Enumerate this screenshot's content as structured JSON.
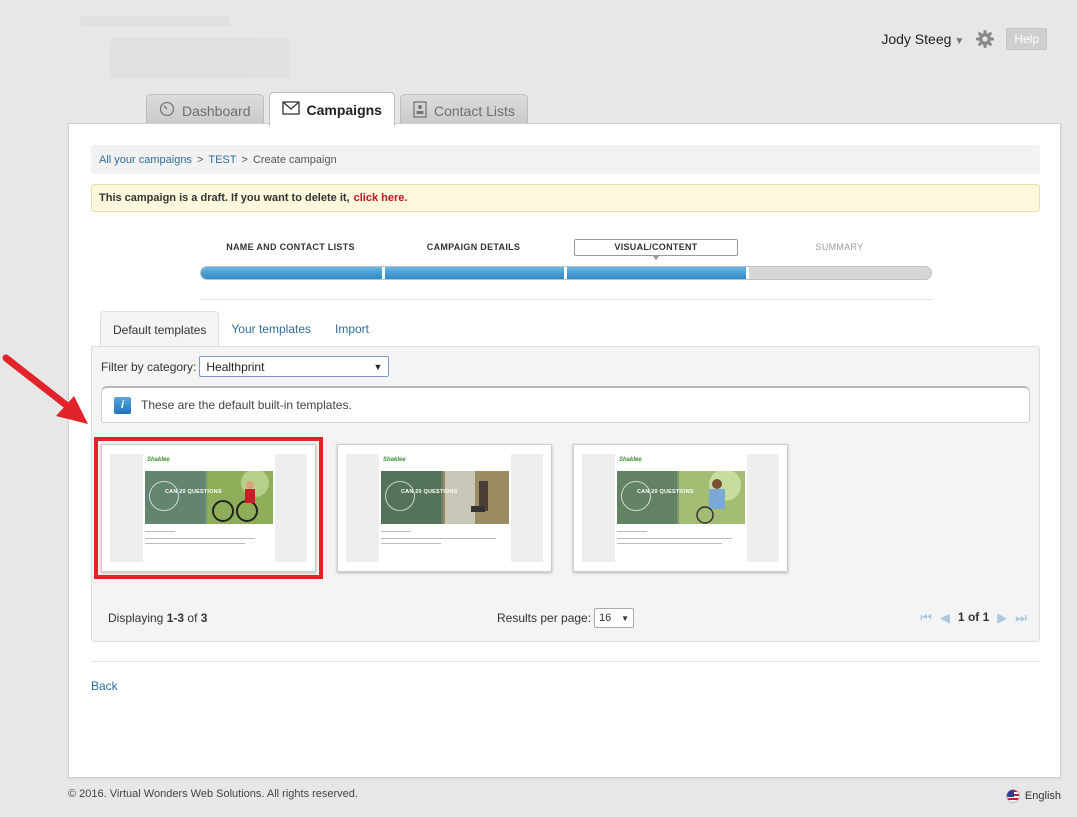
{
  "header": {
    "user_name": "Jody Steeg",
    "user_caret": "▼",
    "help_label": "Help"
  },
  "main_tabs": [
    {
      "label": "Dashboard",
      "icon": "dashboard-gauge-icon",
      "active": false
    },
    {
      "label": "Campaigns",
      "icon": "envelope-icon",
      "active": true
    },
    {
      "label": "Contact Lists",
      "icon": "contact-card-icon",
      "active": false
    }
  ],
  "breadcrumb": {
    "items": [
      "All your campaigns",
      "TEST",
      "Create campaign"
    ],
    "separator": ">"
  },
  "draft_notice": {
    "text": "This campaign is a draft. If you want to delete it,",
    "link": "click here."
  },
  "steps": [
    {
      "label": "NAME AND CONTACT LISTS",
      "state": "done"
    },
    {
      "label": "CAMPAIGN DETAILS",
      "state": "done"
    },
    {
      "label": "VISUAL/CONTENT",
      "state": "current"
    },
    {
      "label": "SUMMARY",
      "state": "future"
    }
  ],
  "sub_tabs": [
    {
      "label": "Default templates",
      "active": true
    },
    {
      "label": "Your templates",
      "active": false
    },
    {
      "label": "Import",
      "active": false
    }
  ],
  "filter": {
    "label": "Filter by category:",
    "value": "Healthprint",
    "arrow": "▼"
  },
  "info": {
    "icon": "info-icon",
    "icon_glyph": "i",
    "text": "These are the default built-in templates."
  },
  "templates": [
    {
      "brand": "Shaklee",
      "hero_title": "CAN 20 QUESTIONS",
      "selected": true
    },
    {
      "brand": "Shaklee",
      "hero_title": "CAN 20 QUESTIONS",
      "selected": false
    },
    {
      "brand": "Shaklee",
      "hero_title": "CAN 20 QUESTIONS",
      "selected": false
    }
  ],
  "listing": {
    "displaying_prefix": "Displaying",
    "range": "1-3",
    "of_word": "of",
    "total": "3",
    "results_per_page_label": "Results per page:",
    "results_per_page": "16",
    "page_current": "1",
    "page_of": "of",
    "page_total": "1",
    "first_glyph": "⏮",
    "prev_glyph": "◀",
    "next_glyph": "▶",
    "last_glyph": "⏭"
  },
  "back_label": "Back",
  "footer": {
    "copyright": "© 2016. Virtual Wonders Web Solutions. All rights reserved.",
    "language": "English"
  },
  "colors": {
    "accent_blue": "#2f89c1",
    "link": "#2e6d99",
    "highlight_red": "#e2232a",
    "draft_bg": "#fbf8dd"
  }
}
